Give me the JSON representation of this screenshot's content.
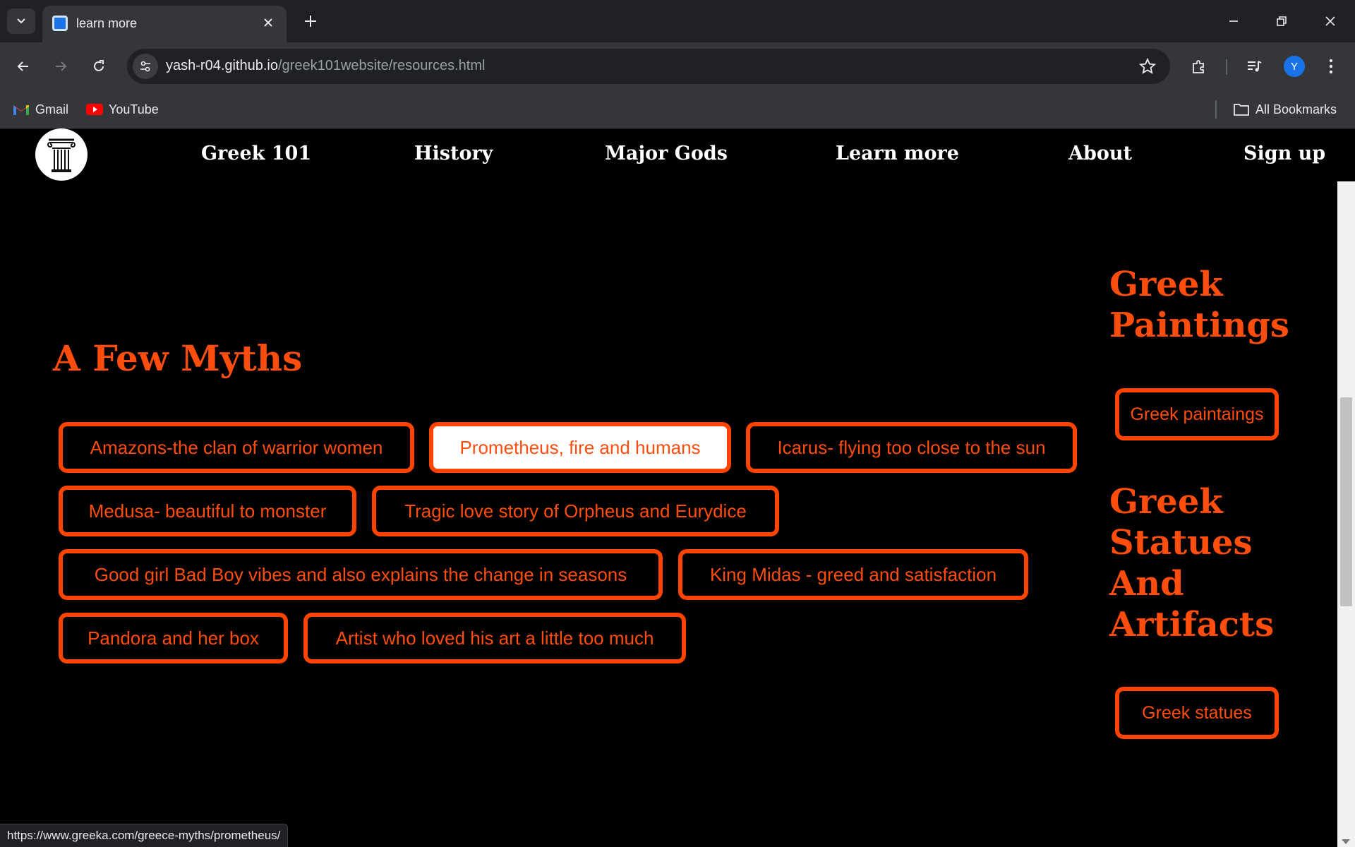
{
  "browser": {
    "tab": {
      "title": "learn more"
    },
    "url": {
      "host": "yash-r04.github.io",
      "path": "/greek101website/resources.html"
    },
    "bookmarks": [
      {
        "label": "Gmail",
        "icon": "gmail-icon"
      },
      {
        "label": "YouTube",
        "icon": "youtube-icon"
      }
    ],
    "all_bookmarks": "All Bookmarks",
    "profile_initial": "Y"
  },
  "site_nav": {
    "logo": "greek-column-icon",
    "links": [
      "Greek 101",
      "History",
      "Major Gods",
      "Learn more",
      "About",
      "Sign up"
    ]
  },
  "myths": {
    "heading": "A Few Myths",
    "buttons": [
      "Amazons-the clan of warrior women",
      "Prometheus, fire and humans",
      "Icarus- flying too close to the sun",
      "Medusa- beautiful to monster",
      "Tragic love story of Orpheus and Eurydice",
      "Good girl Bad Boy vibes and also explains the change in seasons",
      "King Midas - greed and satisfaction",
      "Pandora and her box",
      "Artist who loved his art a little too much"
    ],
    "hovered": "Prometheus, fire and humans"
  },
  "sidebar": {
    "paintings_heading": "Greek Paintings",
    "paintings_button": "Greek paintaings",
    "statues_heading": "Greek Statues And Artifacts",
    "statues_button": "Greek statues"
  },
  "status_url": "https://www.greeka.com/greece-myths/prometheus/",
  "colors": {
    "accent": "#ff4d0d",
    "background": "#000000",
    "chrome": "#35363a"
  }
}
